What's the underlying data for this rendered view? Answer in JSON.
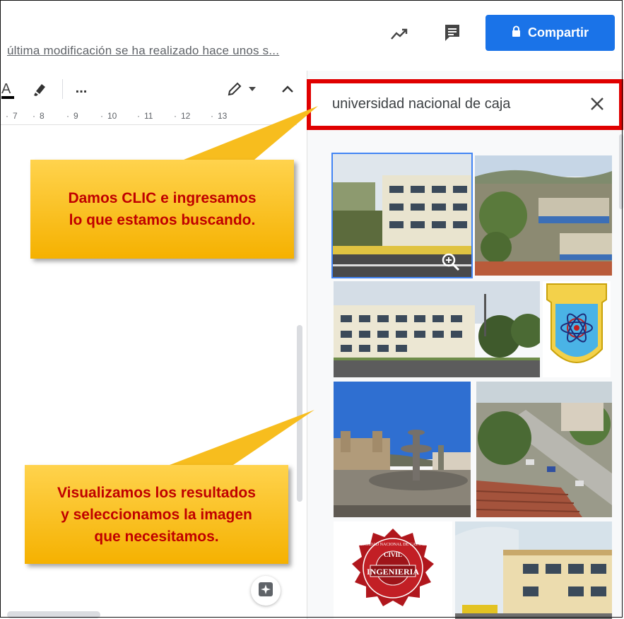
{
  "header": {
    "last_modified": "última modificación se ha realizado hace unos s...",
    "share_label": "Compartir",
    "icons": [
      "activity-trend-icon",
      "comments-icon",
      "lock-icon"
    ]
  },
  "toolbar": {
    "more_label": "...",
    "icons": [
      "text-color-icon",
      "highlighter-icon",
      "more-icon",
      "editing-pencil-icon",
      "dropdown-icon",
      "collapse-icon"
    ]
  },
  "ruler": {
    "ticks": [
      "7",
      "8",
      "9",
      "10",
      "11",
      "12",
      "13"
    ]
  },
  "search": {
    "query": "universidad nacional de caja",
    "icons": [
      "close-icon"
    ]
  },
  "results": {
    "images": [
      "building-photo-1",
      "campus-aerial-photo",
      "building-photo-2",
      "university-crest-emblem",
      "plaza-fountain-photo",
      "street-aerial-photo",
      "ingenieria-civil-seal",
      "building-photo-3"
    ],
    "zoom_icon": "zoom-in-icon"
  },
  "callouts": {
    "top": [
      "Damos CLIC e ingresamos",
      "lo que estamos buscando."
    ],
    "bottom": [
      "Visualizamos los resultados",
      "y seleccionamos la imagen",
      "que necesitamos."
    ]
  },
  "seal_text": {
    "arc": "UNIVERSIDAD NACIONAL DE CAJAMARCA",
    "center": "INGENIERIA",
    "sides": [
      "CIVIL"
    ]
  },
  "colors": {
    "share_blue": "#1a73e8",
    "highlight_red": "#e00000",
    "callout_gold": "#f5b100",
    "callout_text": "#c00000"
  }
}
